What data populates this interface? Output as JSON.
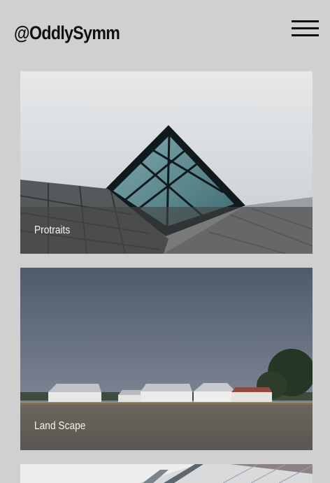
{
  "header": {
    "brand": "@OddlySymm",
    "menu_icon": "hamburger-menu-icon"
  },
  "gallery": {
    "cards": [
      {
        "label": "Protraits",
        "image": "glass-pyramid-building-photo"
      },
      {
        "label": "Land Scape",
        "image": "farm-barns-field-photo"
      },
      {
        "label": "",
        "image": "architecture-partial-photo"
      }
    ]
  },
  "colors": {
    "page_background": "#d0d0d0",
    "brand_text": "#111111",
    "caption_text": "#f4f4f4"
  }
}
